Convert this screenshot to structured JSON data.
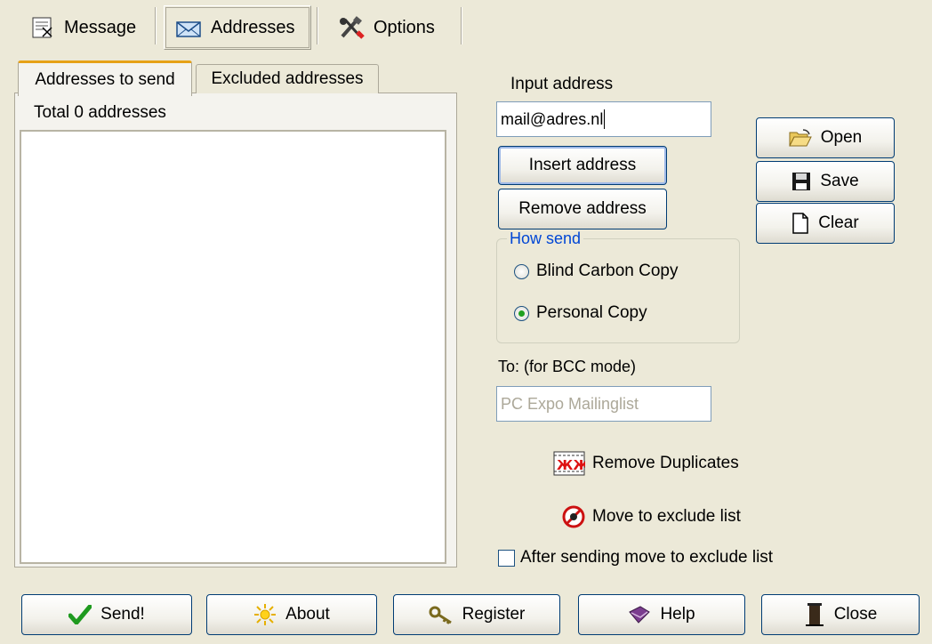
{
  "top_tabs": [
    {
      "label": "Message"
    },
    {
      "label": "Addresses"
    },
    {
      "label": "Options"
    }
  ],
  "address_tabs": {
    "send_label": "Addresses to send",
    "excluded_label": "Excluded addresses"
  },
  "address_list": {
    "total_label": "Total 0 addresses"
  },
  "input": {
    "label": "Input address",
    "value": "mail@adres.nl"
  },
  "buttons": {
    "insert": "Insert address",
    "remove": "Remove address",
    "open": "Open",
    "save": "Save",
    "clear": "Clear"
  },
  "how_send": {
    "legend": "How send",
    "options": [
      {
        "label": "Blind Carbon Copy",
        "selected": false
      },
      {
        "label": "Personal Copy",
        "selected": true
      }
    ]
  },
  "bcc": {
    "label": "To: (for BCC mode)",
    "value": "PC Expo Mailinglist"
  },
  "actions": {
    "remove_duplicates": "Remove Duplicates",
    "move_exclude": "Move to exclude list"
  },
  "after_sending": {
    "label": "After sending move to exclude list",
    "checked": false
  },
  "bottom": {
    "send": "Send!",
    "about": "About",
    "register": "Register",
    "help": "Help",
    "close": "Close"
  }
}
